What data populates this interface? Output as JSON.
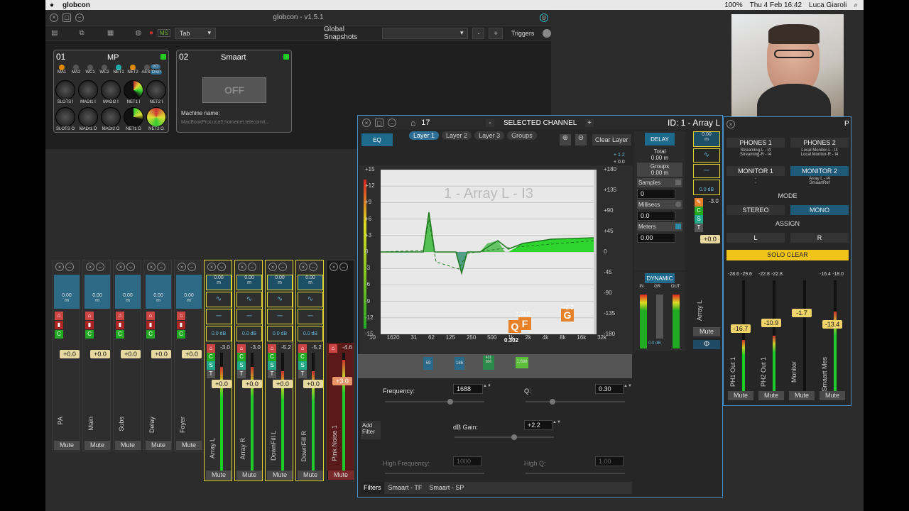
{
  "menubar": {
    "app": "globcon",
    "date": "Thu 4 Feb 16:42",
    "user": "Luca Giaroli",
    "battery": "100%"
  },
  "main": {
    "title": "globcon - v1.5.1",
    "tab_select": "Tab",
    "global_snapshots": "Global Snapshots",
    "triggers": "Triggers",
    "minus": "-",
    "plus": "+",
    "ms": "MS"
  },
  "card1": {
    "num": "01",
    "name": "MP",
    "leds": [
      "MA1",
      "MA2",
      "WC1",
      "WC2",
      "NET1",
      "NET2",
      "AES3"
    ],
    "io": "I/O",
    "dsp": "DSP",
    "knob_row1": [
      "SLOTS I",
      "MADI1 I",
      "MADI2 I",
      "NET1 I",
      "NET2 I"
    ],
    "knob_row2": [
      "SLOTS O",
      "MADI1 O",
      "MADI2 O",
      "NET1 O",
      "NET2 O"
    ]
  },
  "card2": {
    "num": "02",
    "name": "Smaart",
    "state": "OFF",
    "machine_label": "Machine name:",
    "machine_value": "MacBookProLuca3.homenet.telecomit..."
  },
  "strips_left": [
    {
      "name": "PA",
      "level": "0.00",
      "unit": "m",
      "fader": "+0.0",
      "mute": "Mute"
    },
    {
      "name": "Main",
      "level": "0.00",
      "unit": "m",
      "fader": "+0.0",
      "mute": "Mute"
    },
    {
      "name": "Subs",
      "level": "0.00",
      "unit": "m",
      "fader": "+0.0",
      "mute": "Mute"
    },
    {
      "name": "Delay",
      "level": "0.00",
      "unit": "m",
      "fader": "+0.0",
      "mute": "Mute"
    },
    {
      "name": "Foyer",
      "level": "0.00",
      "unit": "m",
      "fader": "+0.0",
      "mute": "Mute"
    }
  ],
  "strips_mid": [
    {
      "name": "Array L",
      "level": "0.00",
      "unit": "m",
      "db": "0.0 dB",
      "peak": "-3.0",
      "fader": "+0.0",
      "mute": "Mute"
    },
    {
      "name": "Array R",
      "level": "0.00",
      "unit": "m",
      "db": "0.0 dB",
      "peak": "-3.0",
      "fader": "+0.0",
      "mute": "Mute"
    },
    {
      "name": "DownFill L",
      "level": "0.00",
      "unit": "m",
      "db": "0.0 dB",
      "peak": "-5.2",
      "fader": "+0.0",
      "mute": "Mute"
    },
    {
      "name": "DownFill R",
      "level": "0.00",
      "unit": "m",
      "db": "0.0 dB",
      "peak": "-5.2",
      "fader": "+0.0",
      "mute": "Mute"
    }
  ],
  "pink": {
    "name": "Pink Noise 1",
    "peak": "-4.6",
    "fader": "+3.0",
    "mute": "Mute"
  },
  "scale": [
    "-6",
    "-12",
    "-18",
    "-24",
    "-30",
    "-36",
    "-42",
    "-48",
    "-54",
    "-60",
    "-66",
    "-72"
  ],
  "sel": {
    "channel_num": "17",
    "title": "SELECTED CHANNEL",
    "id": "ID: 1 - Array L",
    "minus": "-",
    "plus": "+",
    "eq": "EQ",
    "layers": [
      "Layer 1",
      "Layer 2",
      "Layer 3",
      "Groups"
    ],
    "clear_layer": "Clear Layer",
    "graph_label": "1 - Array L - I3",
    "y_left": [
      "+15",
      "+12",
      "+9",
      "+6",
      "+3",
      "0",
      "-3",
      "-6",
      "-9",
      "-12",
      "-15"
    ],
    "y_right": [
      "+180",
      "+135",
      "+90",
      "+45",
      "0",
      "-45",
      "-90",
      "-135",
      "-180"
    ],
    "x_ticks": [
      "10",
      "1620",
      "31",
      "62",
      "125",
      "250",
      "500",
      "1k",
      "2k",
      "4k",
      "8k",
      "16k",
      "32k"
    ],
    "plus12": "+ 1.2",
    "plus0": "+ 0.0",
    "band_markers": [
      "59",
      "186",
      "431\n806",
      "1,688"
    ],
    "q_label": "Q",
    "f_label": "F",
    "g_label": "G",
    "f_val": "1,688",
    "g_val": "+2.2",
    "q_val": "0.302",
    "frequency_label": "Frequency:",
    "frequency": "1688",
    "q_field_label": "Q:",
    "q": "0.30",
    "add_filter": "Add\nFilter",
    "gain_label": "dB Gain:",
    "gain": "+2.2",
    "high_freq_label": "High Frequency:",
    "high_freq": "1000",
    "high_q_label": "High Q:",
    "high_q": "1.00",
    "bottom_tabs": [
      "Filters",
      "Smaart - TF",
      "Smaart - SP"
    ],
    "delay": "DELAY",
    "total": "Total",
    "total_val": "0.00 m",
    "groups": "Groups",
    "groups_val": "0.00 m",
    "samples": "Samples",
    "samples_val": "0",
    "millisecs": "Millisecs",
    "millisecs_val": "0.0",
    "meters": "Meters",
    "meters_val": "0.00",
    "dynamic": "DYNAMIC",
    "dyn_in": "IN",
    "dyn_gr": "GR",
    "dyn_out": "OUT",
    "dyn_db": "0.0 dB",
    "side_level": "0.00",
    "side_unit": "m",
    "side_db": "0.0 dB",
    "side_peak": "-3.0",
    "side_fader": "+0.0",
    "side_name": "Array L",
    "side_mute": "Mute",
    "phi": "Φ"
  },
  "monitor": {
    "p": "P",
    "phones1": "PHONES 1",
    "phones1_sub": "Streaming-L - I4\nStreaming-R - I4",
    "phones2": "PHONES 2",
    "phones2_sub": "Local Monitor-L - I4\nLocal Monitor-R - I4",
    "monitor1": "MONITOR 1",
    "monitor1_sub": "-\n-",
    "monitor2": "MONITOR 2",
    "monitor2_sub": "Array L - I4\nSmaartRef",
    "mode": "MODE",
    "stereo": "STEREO",
    "mono": "MONO",
    "assign": "ASSIGN",
    "l": "L",
    "r": "R",
    "solo_clear": "SOLO CLEAR",
    "strips": [
      {
        "name": "PH1 Out 1",
        "p1": "-28.6",
        "p2": "-29.6",
        "fader": "-16.7",
        "mute": "Mute",
        "level": 0.55
      },
      {
        "name": "PH2 Out 1",
        "p1": "-22.8",
        "p2": "-22.8",
        "fader": "-10.9",
        "mute": "Mute",
        "level": 0.6
      },
      {
        "name": "Monitor",
        "p1": "",
        "p2": "",
        "fader": "-1.7",
        "mute": "Mute",
        "level": 0.0
      },
      {
        "name": "Smaart Mes",
        "p1": "-16.4",
        "p2": "-18.0",
        "fader": "-13.4",
        "mute": "Mute",
        "level": 0.7
      }
    ]
  },
  "colors": {
    "accent": "#2f6f96",
    "yellow": "#f0c419",
    "green": "#1ecb2a",
    "orange": "#e8822a"
  }
}
